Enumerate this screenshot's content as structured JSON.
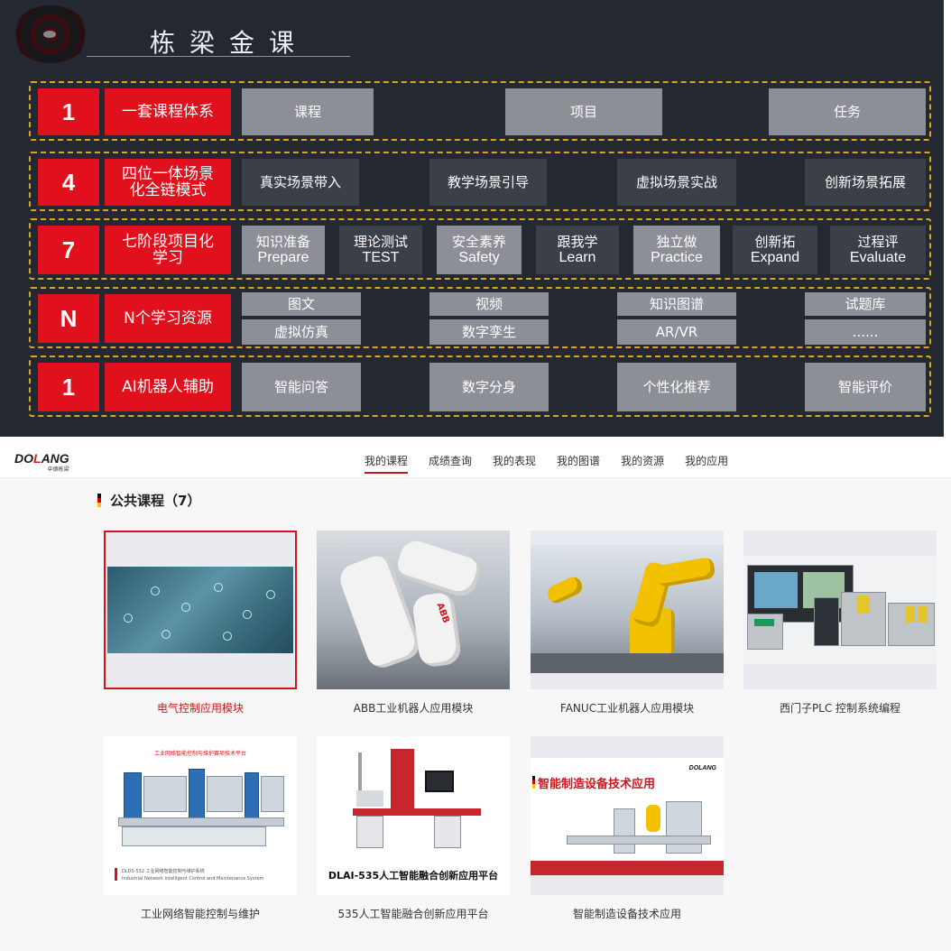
{
  "banner": {
    "title": "栋梁金课",
    "rows": [
      {
        "num": "1",
        "label": "一套课程体系",
        "cells": [
          "课程",
          "项目",
          "任务"
        ]
      },
      {
        "num": "4",
        "label": "四位一体场景化全链模式",
        "cells": [
          "真实场景带入",
          "教学场景引导",
          "虚拟场景实战",
          "创新场景拓展"
        ]
      },
      {
        "num": "7",
        "label": "七阶段项目化学习",
        "cells": [
          {
            "cn": "知识准备",
            "en": "Prepare"
          },
          {
            "cn": "理论测试",
            "en": "TEST"
          },
          {
            "cn": "安全素养",
            "en": "Safety"
          },
          {
            "cn": "跟我学",
            "en": "Learn"
          },
          {
            "cn": "独立做",
            "en": "Practice"
          },
          {
            "cn": "创新拓",
            "en": "Expand"
          },
          {
            "cn": "过程评",
            "en": "Evaluate"
          }
        ]
      },
      {
        "num": "N",
        "label": "N个学习资源",
        "cells": [
          "图文",
          "视频",
          "知识图谱",
          "试题库",
          "虚拟仿真",
          "数字孪生",
          "AR/VR",
          "......"
        ]
      },
      {
        "num": "1",
        "label": "AI机器人辅助",
        "cells": [
          "智能问答",
          "数字分身",
          "个性化推荐",
          "智能评价"
        ]
      }
    ]
  },
  "header": {
    "brand": "DOLANG",
    "brand_sub": "中德栋梁",
    "nav": [
      "我的课程",
      "成绩查询",
      "我的表现",
      "我的图谱",
      "我的资源",
      "我的应用"
    ],
    "active_nav": "我的课程"
  },
  "section": {
    "title": "公共课程（7）"
  },
  "courses": [
    {
      "name": "电气控制应用模块"
    },
    {
      "name": "ABB工业机器人应用模块"
    },
    {
      "name": "FANUC工业机器人应用模块"
    },
    {
      "name": "西门子PLC 控制系统编程"
    },
    {
      "name": "工业网络智能控制与维护",
      "thumb_title": "工业网络智能控制与维护赛项技术平台",
      "thumb_sub": "DLDS-532 工业网络智能控制与维护系统",
      "thumb_sub_en": "Industrial Network Intelligent Control and Maintenance System"
    },
    {
      "name": "535人工智能融合创新应用平台",
      "thumb_title": "DLAI-535人工智能融合创新应用平台"
    },
    {
      "name": "智能制造设备技术应用",
      "thumb_title": "智能制造设备技术应用",
      "thumb_logo": "DOLANG"
    }
  ],
  "colors": {
    "accent_red": "#e0101c",
    "banner_bg": "#232831",
    "dash_gold": "#d7a51e",
    "cell_grey": "#8c8f96"
  }
}
